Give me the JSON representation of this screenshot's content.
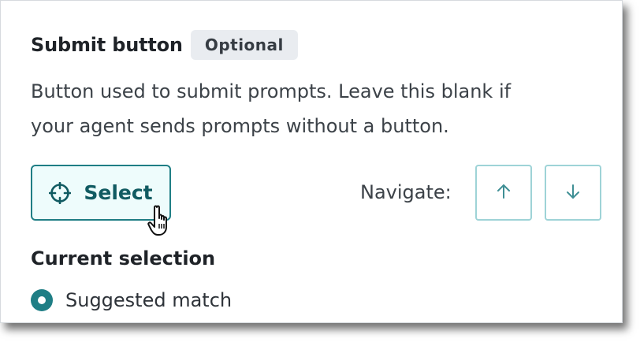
{
  "field": {
    "title": "Submit button",
    "badge": "Optional",
    "description_line1": "Button used to submit prompts. Leave this blank if",
    "description_line2": "your agent sends prompts without a button."
  },
  "select_button": {
    "label": "Select",
    "icon": "crosshair-icon"
  },
  "cursor": {
    "icon": "hand-pointer-icon"
  },
  "navigate": {
    "label": "Navigate:",
    "up_icon": "arrow-up-icon",
    "down_icon": "arrow-down-icon"
  },
  "current_selection": {
    "title": "Current selection",
    "options": [
      {
        "label": "Suggested match",
        "selected": true
      }
    ]
  },
  "colors": {
    "accent": "#1f7e85",
    "accent_light": "#eefcfc",
    "nav_border": "#9ed3d7",
    "badge_bg": "#e9ecf0"
  }
}
